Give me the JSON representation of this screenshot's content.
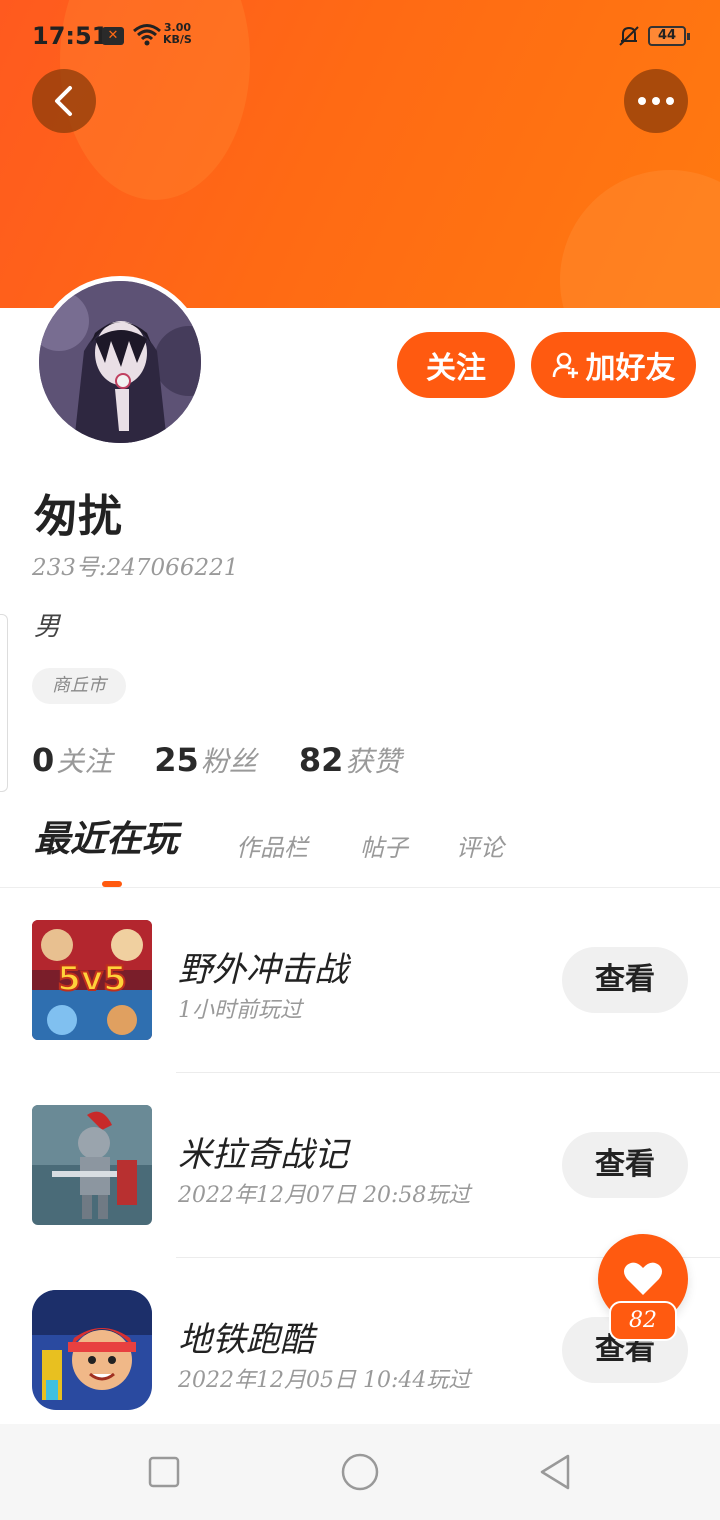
{
  "status_bar": {
    "time": "17:51",
    "notification_icon": "x-icon",
    "wifi_icon": "wifi-icon",
    "network_speed_value": "3.00",
    "network_speed_unit": "KB/S",
    "bell_icon": "bell-muted-icon",
    "battery": "44"
  },
  "header": {
    "back_icon": "back-arrow-icon",
    "more_icon": "more-dots-icon"
  },
  "profile": {
    "name": "匆扰",
    "uid": "233号:247066221",
    "gender": "男",
    "city": "商丘市",
    "follow_label": "关注",
    "add_friend_label": "加好友",
    "stats": [
      {
        "value": "0",
        "label": "关注"
      },
      {
        "value": "25",
        "label": "粉丝"
      },
      {
        "value": "82",
        "label": "获赞"
      }
    ]
  },
  "tabs": [
    {
      "label": "最近在玩",
      "active": true
    },
    {
      "label": "作品栏",
      "active": false
    },
    {
      "label": "帖子",
      "active": false
    },
    {
      "label": "评论",
      "active": false
    }
  ],
  "games": [
    {
      "name": "野外冲击战",
      "time": "1小时前玩过",
      "button": "查看",
      "icon_text": "5v5"
    },
    {
      "name": "米拉奇战记",
      "time": "2022年12月07日 20:58玩过",
      "button": "查看",
      "icon_text": ""
    },
    {
      "name": "地铁跑酷",
      "time": "2022年12月05日 10:44玩过",
      "button": "查看",
      "icon_text": ""
    }
  ],
  "fab": {
    "icon": "heart-icon",
    "count": "82"
  },
  "colors": {
    "accent": "#ff5a10",
    "banner_start": "#ff5a1f",
    "banner_end": "#ff7a10"
  }
}
